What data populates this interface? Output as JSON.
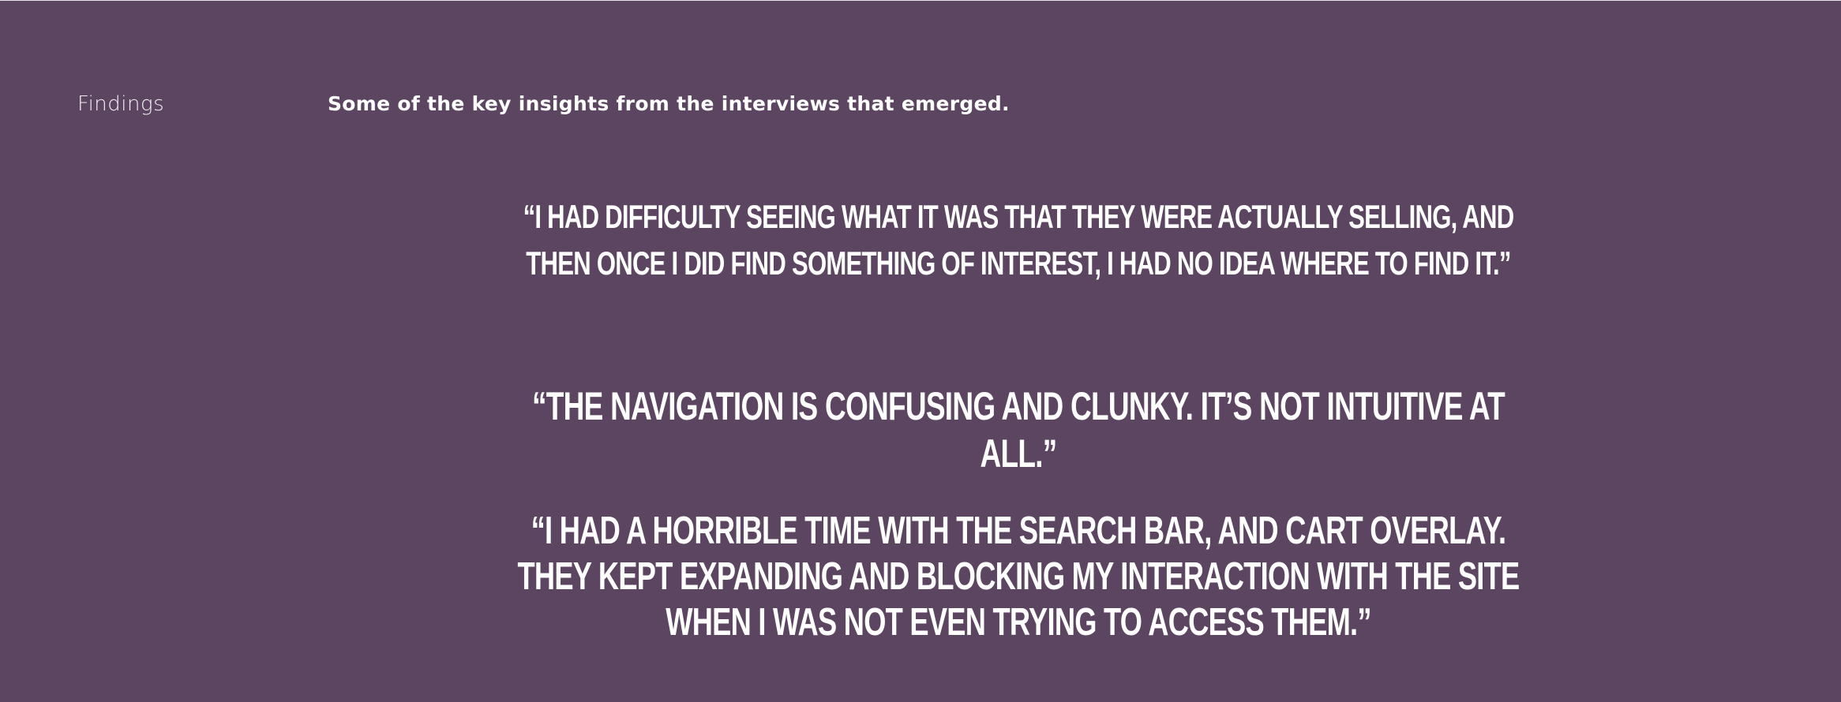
{
  "colors": {
    "background": "#5c4560",
    "text": "#ffffff"
  },
  "section": {
    "label": "Findings",
    "intro": "Some of the key insights from the interviews that emerged."
  },
  "quotes": [
    "“I HAD DIFFICULTY SEEING WHAT IT WAS THAT THEY WERE ACTUALLY SELLING, AND THEN ONCE I DID FIND SOMETHING OF INTEREST, I HAD NO IDEA WHERE TO FIND IT.”",
    "“THE NAVIGATION IS CONFUSING AND CLUNKY. IT’S NOT INTUITIVE AT ALL.”",
    "“I HAD A HORRIBLE TIME WITH THE SEARCH BAR, AND CART OVERLAY. THEY KEPT EXPANDING AND BLOCKING MY INTERACTION WITH THE SITE WHEN I WAS NOT EVEN TRYING TO ACCESS THEM.”"
  ]
}
